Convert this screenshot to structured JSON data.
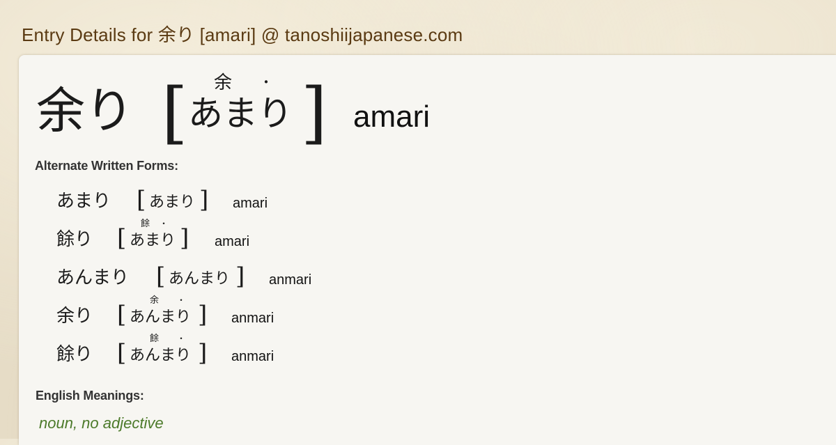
{
  "page_title": "Entry Details for 余り [amari] @ tanoshiijapanese.com",
  "main": {
    "word": "余り",
    "bracket_left": "[",
    "bracket_right": "]",
    "reading": "あまり",
    "furigana": "余",
    "accent_dot": "・",
    "romaji": "amari"
  },
  "alternate_heading": "Alternate Written Forms:",
  "alternates": [
    {
      "word": "あまり",
      "reading": "あまり",
      "furigana": "",
      "romaji": "amari"
    },
    {
      "word": "餘り",
      "reading": "あまり",
      "furigana": "餘",
      "romaji": "amari"
    },
    {
      "word": "あんまり",
      "reading": "あんまり",
      "furigana": "",
      "romaji": "anmari"
    },
    {
      "word": "余り",
      "reading": "あんまり",
      "furigana": "余",
      "romaji": "anmari"
    },
    {
      "word": "餘り",
      "reading": "あんまり",
      "furigana": "餘",
      "romaji": "anmari"
    }
  ],
  "meanings_heading": "English Meanings:",
  "meaning_pos": "noun, no adjective",
  "colors": {
    "title": "#5a3a12",
    "card": "#f7f6f2",
    "background": "#e6dcc6",
    "meaning": "#4c7a2a"
  }
}
